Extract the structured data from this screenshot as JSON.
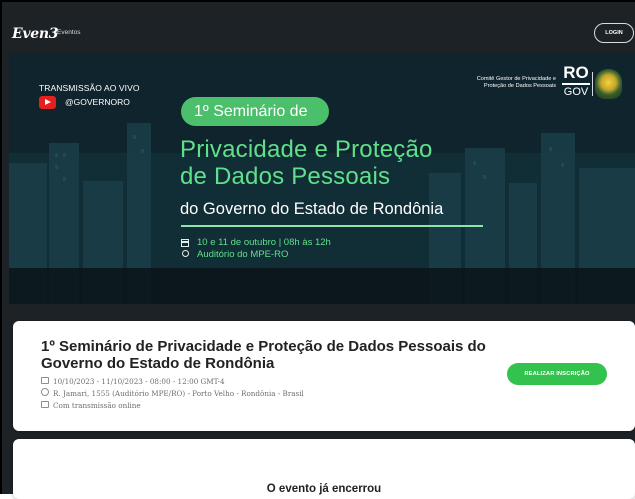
{
  "header": {
    "brand": "Even3",
    "brand_sub": "Eventos",
    "login_label": "LOGIN"
  },
  "banner": {
    "live_label": "TRANSMISSÃO AO VIVO",
    "channel": "@GOVERNORO",
    "pill": "1º Seminário de",
    "headline_line1": "Privacidade e Proteção",
    "headline_line2": "de Dados Pessoais",
    "subline": "do Governo do Estado de Rondônia",
    "date_time": "10 e 11 de outubro | 08h às 12h",
    "venue": "Auditório do MPE-RO",
    "committee": "Comitê Gestor de Privacidade e Proteção de Dados Pessoais",
    "ro": "RO",
    "gov": "GOV"
  },
  "event": {
    "title": "1º Seminário de Privacidade e Proteção de Dados Pessoais do Governo do Estado de Rondônia",
    "date": "10/10/2023 - 11/10/2023 - 08:00 - 12:00 GMT-4",
    "location": "R. Jamari, 1555 (Auditório MPE/RO) - Porto Velho - Rondônia - Brasil",
    "online": "Com transmissão online",
    "register_label": "REALIZAR INSCRIÇÃO"
  },
  "status": {
    "ended": "O evento já encerrou"
  },
  "colors": {
    "accent_green": "#32c24d",
    "headline_green": "#5fe08a",
    "header_bg": "#1c2226"
  }
}
